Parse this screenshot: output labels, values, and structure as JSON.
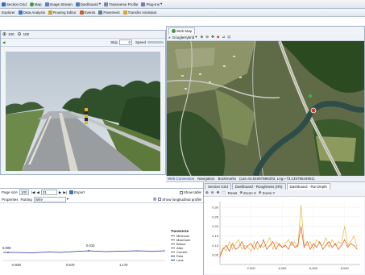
{
  "menu_bar": {
    "items": [
      {
        "label": "Section Grid",
        "color": "#2f6fb5"
      },
      {
        "label": "Map",
        "color": "#3a9a3a"
      },
      {
        "label": "Image Stream",
        "color": "#5b7db8"
      },
      {
        "label": "Dashboard",
        "color": "#4f79b9"
      },
      {
        "label": "Transverse Profile",
        "color": "#7a8aa3"
      },
      {
        "label": "Plug-Ins",
        "color": "#8a6fb5"
      }
    ]
  },
  "secondary_bar": {
    "items": [
      {
        "label": "Explorer",
        "color": ""
      },
      {
        "label": "Data Analysis",
        "color": "#3a78c2"
      },
      {
        "label": "Routing Editor",
        "color": "#c9a12e"
      },
      {
        "label": "Events",
        "color": "#d25a2a"
      },
      {
        "label": "Pavement",
        "color": "#6a7d92"
      },
      {
        "label": "Transfer Assistant",
        "color": "#d8a630"
      }
    ]
  },
  "image_panel": {
    "zoom_label": "100",
    "skip_label": "Skip",
    "skip_value": "0",
    "speed_label": "Speed"
  },
  "map_panel": {
    "tab_label": "Web Map",
    "provider_label": "GoogleHybrid",
    "colors": {
      "river": "#2f4d48",
      "forest": "#2c4a20",
      "field": "#7c8c58",
      "road": "#c8c8c0"
    }
  },
  "status_bar": {
    "items": [
      "Web Connection",
      "Navigation",
      "Bookmarks"
    ],
    "coords": "(Lat=44.81697886303, Lng=-73.14578644951)"
  },
  "profile_panel": {
    "page_size_label": "Page size",
    "page_size_value": "100",
    "page_value": "31",
    "export_label": "Export",
    "show_table_label": "Show table",
    "properties_label": "Properties",
    "rutting_label": "Rutting",
    "rutting_value": "Wire",
    "show_long_profile_label": "Show longitudinal profile",
    "annotation_left": "0.006",
    "annotation_mid": "0.010",
    "ticks": [
      "-0.030",
      "0.570",
      "1.170"
    ],
    "legend_title": "Transverse",
    "legend_items": [
      {
        "label": "Minimum",
        "color": "#6a6a6a"
      },
      {
        "label": "Maximum",
        "color": "#6a6a6a"
      },
      {
        "label": "Before",
        "color": "#6a6a6a"
      },
      {
        "label": "After",
        "color": "#6a6a6a"
      },
      {
        "label": "Current",
        "color": "#6a6a6a"
      },
      {
        "label": "Ruts",
        "color": "#2233aa"
      },
      {
        "label": "Lane",
        "color": "#2233aa"
      }
    ]
  },
  "dashboard_panel": {
    "tabs": [
      "Section Grid",
      "Dashboard - Roughness (IRI)",
      "Dashboard - Rut Depth"
    ],
    "active_tab": 2,
    "buttons": {
      "reset": "Reset",
      "zoom_x": "Zoom X",
      "zoom_y": "Zoom Y"
    }
  },
  "chart_data": {
    "type": "line",
    "title": "",
    "xlabel": "",
    "ylabel": "",
    "xlim": [
      0,
      9000
    ],
    "ylim": [
      0,
      0.33
    ],
    "x_ticks": [
      "2,000",
      "4,000",
      "6,000",
      "8,000"
    ],
    "y_ticks": [
      "0.05",
      "0.10",
      "0.15",
      "0.20",
      "0.25",
      "0.30"
    ],
    "series": [
      {
        "name": "",
        "color": "#e8b63a",
        "x": [
          0,
          200,
          400,
          600,
          800,
          1000,
          1200,
          1400,
          1600,
          1800,
          2000,
          2200,
          2400,
          2600,
          2800,
          3000,
          3200,
          3400,
          3600,
          3800,
          4000,
          4200,
          4400,
          4600,
          4800,
          5000,
          5200,
          5400,
          5600,
          5800,
          6000,
          6200,
          6400,
          6600,
          6800,
          7000,
          7200,
          7400,
          7600,
          7800,
          8000,
          8200,
          8400,
          8600,
          8800
        ],
        "values": [
          0.05,
          0.09,
          0.07,
          0.12,
          0.08,
          0.11,
          0.13,
          0.08,
          0.1,
          0.09,
          0.07,
          0.12,
          0.08,
          0.1,
          0.09,
          0.11,
          0.14,
          0.08,
          0.12,
          0.1,
          0.09,
          0.11,
          0.13,
          0.1,
          0.12,
          0.09,
          0.31,
          0.11,
          0.1,
          0.12,
          0.08,
          0.13,
          0.11,
          0.1,
          0.14,
          0.09,
          0.13,
          0.1,
          0.12,
          0.11,
          0.2,
          0.1,
          0.12,
          0.15,
          0.09
        ]
      },
      {
        "name": "",
        "color": "#d9541e",
        "x": [
          0,
          200,
          400,
          600,
          800,
          1000,
          1200,
          1400,
          1600,
          1800,
          2000,
          2200,
          2400,
          2600,
          2800,
          3000,
          3200,
          3400,
          3600,
          3800,
          4000,
          4200,
          4400,
          4600,
          4800,
          5000,
          5200,
          5400,
          5600,
          5800,
          6000,
          6200,
          6400,
          6600,
          6800,
          7000,
          7200,
          7400,
          7600,
          7800,
          8000,
          8200,
          8400,
          8600,
          8800
        ],
        "values": [
          0.04,
          0.08,
          0.1,
          0.07,
          0.11,
          0.08,
          0.09,
          0.12,
          0.08,
          0.1,
          0.11,
          0.08,
          0.12,
          0.09,
          0.13,
          0.08,
          0.1,
          0.12,
          0.08,
          0.11,
          0.09,
          0.1,
          0.08,
          0.12,
          0.09,
          0.1,
          0.2,
          0.09,
          0.12,
          0.08,
          0.11,
          0.09,
          0.12,
          0.08,
          0.1,
          0.12,
          0.09,
          0.11,
          0.08,
          0.1,
          0.13,
          0.09,
          0.11,
          0.1,
          0.08
        ]
      }
    ]
  }
}
